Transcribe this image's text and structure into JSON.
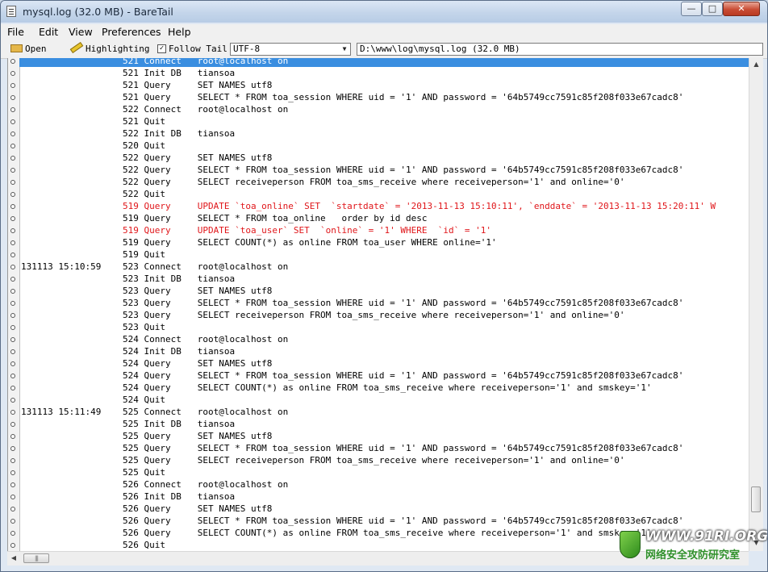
{
  "window": {
    "title": "mysql.log (32.0 MB) - BareTail"
  },
  "controls": {
    "minimize": "—",
    "maximize": "□",
    "close": "✕"
  },
  "menu": [
    "File",
    "Edit",
    "View",
    "Preferences",
    "Help"
  ],
  "toolbar": {
    "open_label": "Open",
    "highlighting_label": "Highlighting",
    "follow_tail_label": "Follow Tail",
    "follow_tail_checked": true,
    "encoding_value": "UTF-8",
    "file_path": "D:\\www\\log\\mysql.log (32.0 MB)"
  },
  "colors": {
    "highlight_line": "#3a8ee0",
    "error_text": "#e0161a"
  },
  "log_lines": [
    {
      "time": "",
      "text": "521 Connect   root@localhost on",
      "style": "highlight"
    },
    {
      "time": "",
      "text": "521 Init DB   tiansoa",
      "style": "normal"
    },
    {
      "time": "",
      "text": "521 Query     SET NAMES utf8",
      "style": "normal"
    },
    {
      "time": "",
      "text": "521 Query     SELECT * FROM toa_session WHERE uid = '1' AND password = '64b5749cc7591c85f208f033e67cadc8'",
      "style": "normal"
    },
    {
      "time": "",
      "text": "522 Connect   root@localhost on",
      "style": "normal"
    },
    {
      "time": "",
      "text": "521 Quit",
      "style": "normal"
    },
    {
      "time": "",
      "text": "522 Init DB   tiansoa",
      "style": "normal"
    },
    {
      "time": "",
      "text": "520 Quit",
      "style": "normal"
    },
    {
      "time": "",
      "text": "522 Query     SET NAMES utf8",
      "style": "normal"
    },
    {
      "time": "",
      "text": "522 Query     SELECT * FROM toa_session WHERE uid = '1' AND password = '64b5749cc7591c85f208f033e67cadc8'",
      "style": "normal"
    },
    {
      "time": "",
      "text": "522 Query     SELECT receiveperson FROM toa_sms_receive where receiveperson='1' and online='0'",
      "style": "normal"
    },
    {
      "time": "",
      "text": "522 Quit",
      "style": "normal"
    },
    {
      "time": "",
      "text": "519 Query     UPDATE `toa_online` SET  `startdate` = '2013-11-13 15:10:11', `enddate` = '2013-11-13 15:20:11' W",
      "style": "red"
    },
    {
      "time": "",
      "text": "519 Query     SELECT * FROM toa_online   order by id desc",
      "style": "normal"
    },
    {
      "time": "",
      "text": "519 Query     UPDATE `toa_user` SET  `online` = '1' WHERE  `id` = '1'",
      "style": "red"
    },
    {
      "time": "",
      "text": "519 Query     SELECT COUNT(*) as online FROM toa_user WHERE online='1'",
      "style": "normal"
    },
    {
      "time": "",
      "text": "519 Quit",
      "style": "normal"
    },
    {
      "time": "131113 15:10:59",
      "text": "523 Connect   root@localhost on",
      "style": "normal"
    },
    {
      "time": "",
      "text": "523 Init DB   tiansoa",
      "style": "normal"
    },
    {
      "time": "",
      "text": "523 Query     SET NAMES utf8",
      "style": "normal"
    },
    {
      "time": "",
      "text": "523 Query     SELECT * FROM toa_session WHERE uid = '1' AND password = '64b5749cc7591c85f208f033e67cadc8'",
      "style": "normal"
    },
    {
      "time": "",
      "text": "523 Query     SELECT receiveperson FROM toa_sms_receive where receiveperson='1' and online='0'",
      "style": "normal"
    },
    {
      "time": "",
      "text": "523 Quit",
      "style": "normal"
    },
    {
      "time": "",
      "text": "524 Connect   root@localhost on",
      "style": "normal"
    },
    {
      "time": "",
      "text": "524 Init DB   tiansoa",
      "style": "normal"
    },
    {
      "time": "",
      "text": "524 Query     SET NAMES utf8",
      "style": "normal"
    },
    {
      "time": "",
      "text": "524 Query     SELECT * FROM toa_session WHERE uid = '1' AND password = '64b5749cc7591c85f208f033e67cadc8'",
      "style": "normal"
    },
    {
      "time": "",
      "text": "524 Query     SELECT COUNT(*) as online FROM toa_sms_receive where receiveperson='1' and smskey='1'",
      "style": "normal"
    },
    {
      "time": "",
      "text": "524 Quit",
      "style": "normal"
    },
    {
      "time": "131113 15:11:49",
      "text": "525 Connect   root@localhost on",
      "style": "normal"
    },
    {
      "time": "",
      "text": "525 Init DB   tiansoa",
      "style": "normal"
    },
    {
      "time": "",
      "text": "525 Query     SET NAMES utf8",
      "style": "normal"
    },
    {
      "time": "",
      "text": "525 Query     SELECT * FROM toa_session WHERE uid = '1' AND password = '64b5749cc7591c85f208f033e67cadc8'",
      "style": "normal"
    },
    {
      "time": "",
      "text": "525 Query     SELECT receiveperson FROM toa_sms_receive where receiveperson='1' and online='0'",
      "style": "normal"
    },
    {
      "time": "",
      "text": "525 Quit",
      "style": "normal"
    },
    {
      "time": "",
      "text": "526 Connect   root@localhost on",
      "style": "normal"
    },
    {
      "time": "",
      "text": "526 Init DB   tiansoa",
      "style": "normal"
    },
    {
      "time": "",
      "text": "526 Query     SET NAMES utf8",
      "style": "normal"
    },
    {
      "time": "",
      "text": "526 Query     SELECT * FROM toa_session WHERE uid = '1' AND password = '64b5749cc7591c85f208f033e67cadc8'",
      "style": "normal"
    },
    {
      "time": "",
      "text": "526 Query     SELECT COUNT(*) as online FROM toa_sms_receive where receiveperson='1' and smskey='1'",
      "style": "normal"
    },
    {
      "time": "",
      "text": "526 Quit",
      "style": "normal"
    }
  ],
  "watermark": {
    "url": "WWW.91RI.ORG",
    "text": "网络安全攻防研究室"
  }
}
